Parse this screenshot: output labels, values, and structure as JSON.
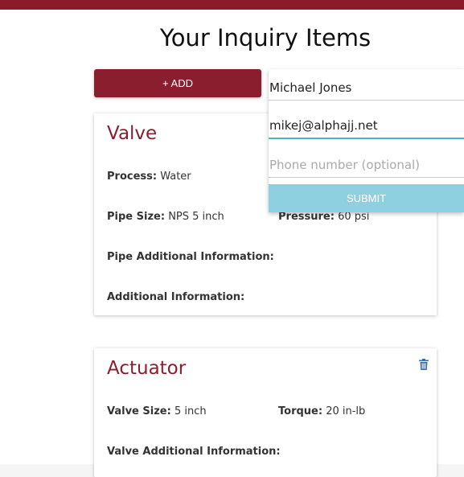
{
  "header": {
    "title": "Your Inquiry Items"
  },
  "toolbar": {
    "add_label": "+ ADD"
  },
  "items": [
    {
      "title": "Valve",
      "fields": [
        {
          "label": "Process:",
          "value": "Water"
        },
        {
          "label": "Pipe Size:",
          "value": "NPS 5 inch"
        },
        {
          "label": "Pressure:",
          "value": "60 psi"
        },
        {
          "label": "Pipe Additional Information:",
          "value": ""
        },
        {
          "label": "Additional Information:",
          "value": ""
        }
      ]
    },
    {
      "title": "Actuator",
      "delete_icon": "trash-icon",
      "fields": [
        {
          "label": "Valve Size:",
          "value": "5 inch"
        },
        {
          "label": "Torque:",
          "value": "20 in-lb"
        },
        {
          "label": "Valve Additional Information:",
          "value": ""
        }
      ]
    }
  ],
  "contact_form": {
    "name_value": "Michael Jones",
    "email_value": "mikej@alphajj.net",
    "phone_placeholder": "Phone number (optional)",
    "submit_label": "Submit"
  },
  "colors": {
    "brand": "#8b1e2e",
    "accent": "#4fb3bf",
    "submit": "#8fd0e0"
  }
}
